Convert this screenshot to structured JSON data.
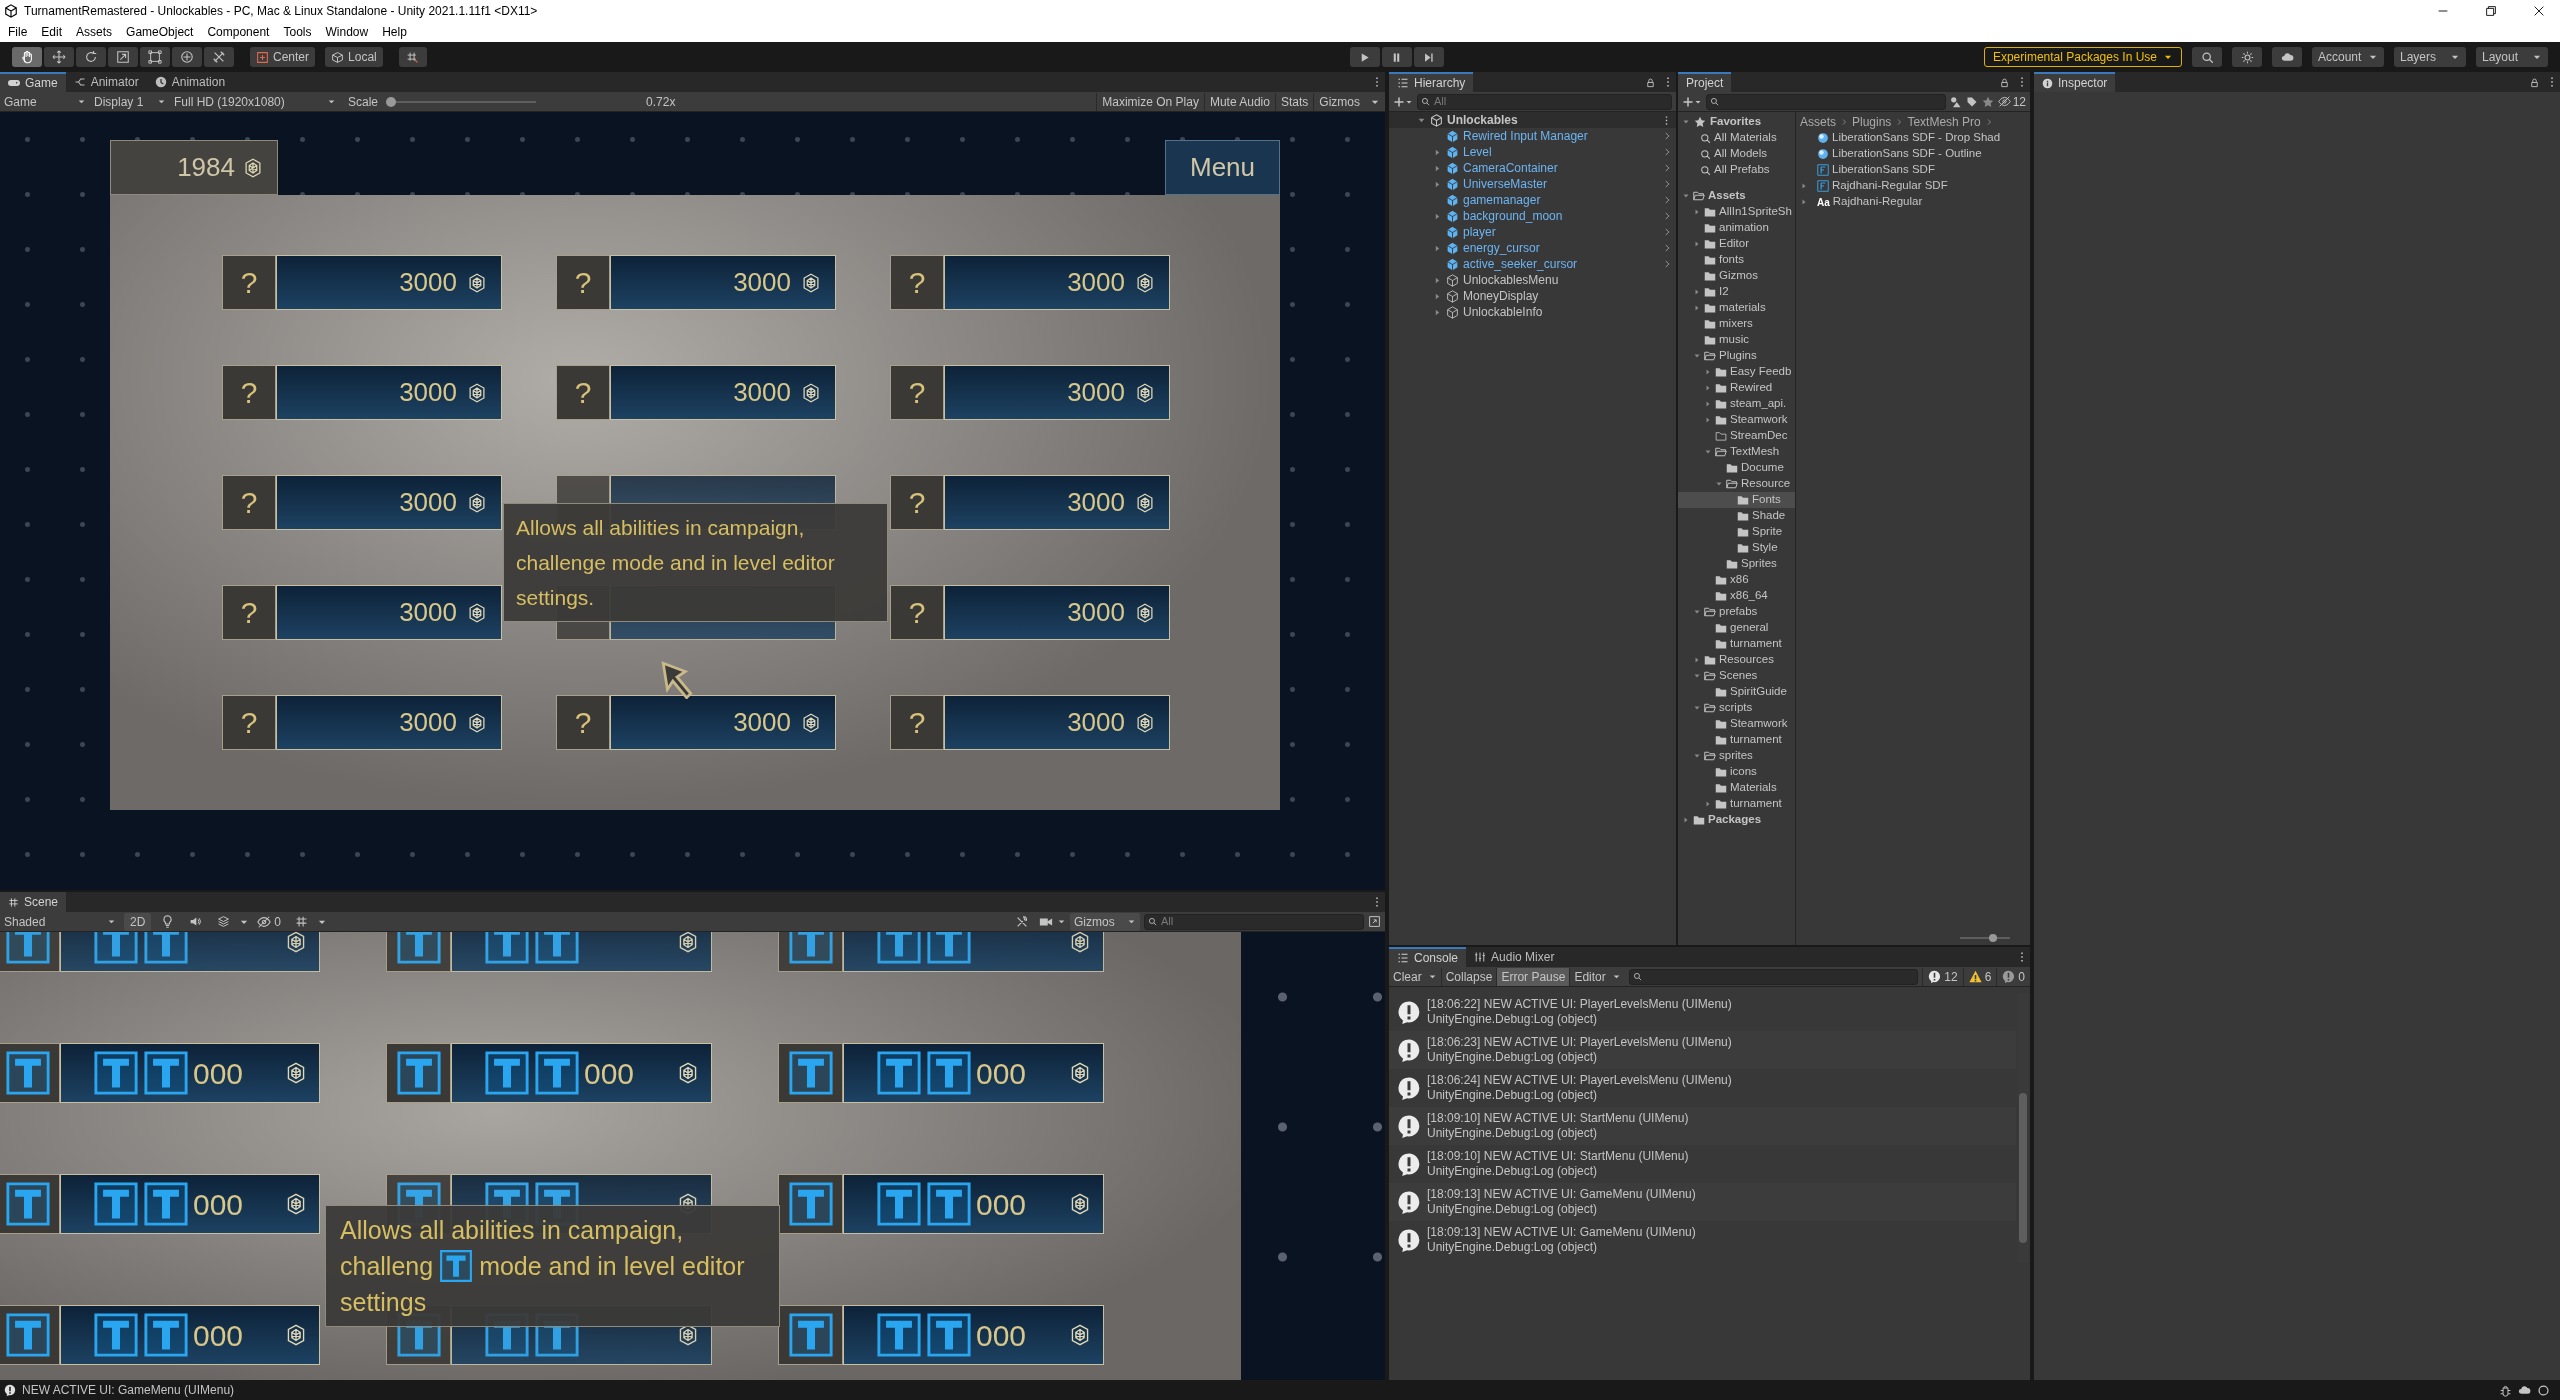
{
  "window": {
    "title": "TurnamentRemastered - Unlockables - PC, Mac & Linux Standalone - Unity 2021.1.11f1 <DX11>"
  },
  "menu_bar": [
    "File",
    "Edit",
    "Assets",
    "GameObject",
    "Component",
    "Tools",
    "Window",
    "Help"
  ],
  "toolbar": {
    "tools": [
      {
        "kind": "hand",
        "selected": true
      },
      {
        "kind": "move",
        "selected": false
      },
      {
        "kind": "rotate",
        "selected": false
      },
      {
        "kind": "scale",
        "selected": false
      },
      {
        "kind": "rect",
        "selected": false
      },
      {
        "kind": "transform",
        "selected": false
      },
      {
        "kind": "custom",
        "selected": false
      }
    ],
    "pivot": "Center",
    "space": "Local",
    "experimental": "Experimental Packages In Use",
    "account": "Account",
    "layers": "Layers",
    "layout": "Layout"
  },
  "game_panel": {
    "tabs": [
      {
        "label": "Game",
        "kind": "game",
        "selected": true
      },
      {
        "label": "Animator",
        "kind": "animator",
        "selected": false
      },
      {
        "label": "Animation",
        "kind": "animation",
        "selected": false
      }
    ],
    "view_mode": "Game",
    "display": "Display 1",
    "resolution": "Full HD (1920x1080)",
    "scale_label": "Scale",
    "scale": {
      "level": 0.0
    },
    "scale_reading": "0.72x",
    "options": [
      "Maximize On Play",
      "Mute Audio",
      "Stats",
      "Gizmos"
    ],
    "money": "1984",
    "menu_button": "Menu",
    "cards": [
      {
        "label": "?",
        "price": "3000"
      },
      {
        "label": "?",
        "price": "3000"
      },
      {
        "label": "?",
        "price": "3000"
      },
      {
        "label": "?",
        "price": "3000"
      },
      {
        "label": "?",
        "price": "3000"
      },
      {
        "label": "?",
        "price": "3000"
      },
      {
        "label": "?",
        "price": "3000"
      },
      {
        "covered": true
      },
      {
        "label": "?",
        "price": "3000"
      },
      {
        "label": "?",
        "price": "3000"
      },
      {
        "covered": true
      },
      {
        "label": "?",
        "price": "3000"
      },
      {
        "label": "?",
        "price": "3000"
      },
      {
        "label": "?",
        "price": "3000"
      },
      {
        "label": "?",
        "price": "3000"
      }
    ],
    "tooltip": [
      "Allows all abilities in campaign,",
      "challenge mode and in level editor",
      "settings."
    ]
  },
  "scene_panel": {
    "tab": "Scene",
    "shading": "Shaded",
    "mode_2d": "2D",
    "hidden_count": "0",
    "gizmos": "Gizmos",
    "search": {
      "placeholder": "All"
    },
    "cards": [
      {
        "covered": true
      },
      {
        "covered": true
      },
      {
        "covered": true
      },
      {
        "price": "000"
      },
      {
        "price": "000"
      },
      {
        "price": "000"
      },
      {
        "price": "000"
      },
      {
        "covered": true
      },
      {
        "price": "000"
      },
      {
        "price": "000"
      },
      {
        "covered": true
      },
      {
        "price": "000"
      }
    ],
    "tooltip": [
      [
        "Allows all abilities in campaign,"
      ],
      [
        "challeng",
        "mode and in level editor"
      ],
      [
        "settings"
      ]
    ]
  },
  "hierarchy": {
    "title": "Hierarchy",
    "search": {
      "placeholder": "All"
    },
    "scene": "Unlockables",
    "items": [
      {
        "label": "Rewired Input Manager",
        "kind": "prefab",
        "expandable": false
      },
      {
        "label": "Level",
        "kind": "prefab",
        "expandable": true
      },
      {
        "label": "CameraContainer",
        "kind": "prefab",
        "expandable": true
      },
      {
        "label": "UniverseMaster",
        "kind": "prefab",
        "expandable": true
      },
      {
        "label": "gamemanager",
        "kind": "prefab",
        "expandable": false
      },
      {
        "label": "background_moon",
        "kind": "prefab",
        "expandable": true
      },
      {
        "label": "player",
        "kind": "prefab",
        "expandable": false
      },
      {
        "label": "energy_cursor",
        "kind": "prefab",
        "expandable": true
      },
      {
        "label": "active_seeker_cursor",
        "kind": "prefab",
        "expandable": false
      },
      {
        "label": "UnlockablesMenu",
        "kind": "object",
        "expandable": true
      },
      {
        "label": "MoneyDisplay",
        "kind": "object",
        "expandable": true
      },
      {
        "label": "UnlockableInfo",
        "kind": "object",
        "expandable": true
      }
    ]
  },
  "project": {
    "title": "Project",
    "hidden_count": "12",
    "favorites_label": "Favorites",
    "favorites": [
      "All Materials",
      "All Models",
      "All Prefabs"
    ],
    "tree": [
      {
        "label": "Assets",
        "selected": false,
        "expanded": true,
        "children": [
          {
            "label": "AllIn1SpriteSh",
            "selected": false,
            "expanded": false
          },
          {
            "label": "animation",
            "selected": false
          },
          {
            "label": "Editor",
            "selected": false,
            "expanded": false
          },
          {
            "label": "fonts",
            "selected": false
          },
          {
            "label": "Gizmos",
            "selected": false
          },
          {
            "label": "I2",
            "selected": false,
            "expanded": false
          },
          {
            "label": "materials",
            "selected": false,
            "expanded": false
          },
          {
            "label": "mixers",
            "selected": false
          },
          {
            "label": "music",
            "selected": false
          },
          {
            "label": "Plugins",
            "selected": false,
            "expanded": true,
            "children": [
              {
                "label": "Easy Feedb",
                "kind": "folder",
                "selected": false,
                "expanded": false
              },
              {
                "label": "Rewired",
                "kind": "folder",
                "selected": false,
                "expanded": false
              },
              {
                "label": "steam_api.",
                "kind": "folder",
                "selected": false,
                "expanded": false
              },
              {
                "label": "Steamwork",
                "kind": "folder",
                "selected": false,
                "expanded": false
              },
              {
                "label": "StreamDec",
                "kind": "empty_folder",
                "selected": false
              },
              {
                "label": "TextMesh",
                "kind": "folder",
                "selected": false,
                "expanded": true,
                "children": [
                  {
                    "label": "Docume",
                    "selected": false
                  },
                  {
                    "label": "Resource",
                    "selected": false,
                    "expanded": true,
                    "children": [
                      {
                        "label": "Fonts",
                        "selected": true
                      },
                      {
                        "label": "Shade",
                        "selected": false
                      },
                      {
                        "label": "Sprite",
                        "selected": false
                      },
                      {
                        "label": "Style",
                        "selected": false
                      }
                    ]
                  },
                  {
                    "label": "Sprites",
                    "selected": false
                  }
                ]
              },
              {
                "label": "x86",
                "kind": "folder",
                "selected": false
              },
              {
                "label": "x86_64",
                "kind": "folder",
                "selected": false
              }
            ]
          },
          {
            "label": "prefabs",
            "selected": false,
            "expanded": true,
            "children": [
              {
                "label": "general",
                "selected": false
              },
              {
                "label": "turnament",
                "selected": false
              }
            ]
          },
          {
            "label": "Resources",
            "selected": false,
            "expanded": false
          },
          {
            "label": "Scenes",
            "selected": false,
            "expanded": true,
            "children": [
              {
                "label": "SpiritGuide",
                "selected": false
              }
            ]
          },
          {
            "label": "scripts",
            "selected": false,
            "expanded": true,
            "children": [
              {
                "label": "Steamwork",
                "selected": false
              },
              {
                "label": "turnament",
                "selected": false
              }
            ]
          },
          {
            "label": "sprites",
            "selected": false,
            "expanded": true,
            "children": [
              {
                "label": "icons",
                "selected": false
              },
              {
                "label": "Materials",
                "selected": false
              },
              {
                "label": "turnament",
                "selected": false,
                "expanded": false
              }
            ]
          }
        ]
      },
      {
        "label": "Packages",
        "selected": false,
        "expanded": false
      }
    ],
    "breadcrumb": [
      "Assets",
      "Plugins",
      "TextMesh Pro"
    ],
    "files": [
      {
        "label": "LiberationSans SDF - Drop Shad",
        "kind": "material",
        "expandable": false
      },
      {
        "label": "LiberationSans SDF - Outline",
        "kind": "material",
        "expandable": false
      },
      {
        "label": "LiberationSans SDF",
        "kind": "font_asset",
        "expandable": false
      },
      {
        "label": "Rajdhani-Regular SDF",
        "kind": "font_asset",
        "expandable": true
      },
      {
        "label": "Rajdhani-Regular",
        "kind": "font",
        "badge": "Aa",
        "expandable": true
      }
    ],
    "icon_size": {
      "level": 0.7
    }
  },
  "console": {
    "tabs": [
      {
        "label": "Console",
        "kind": "console",
        "selected": true
      },
      {
        "label": "Audio Mixer",
        "kind": "mixer",
        "selected": false
      }
    ],
    "buttons": [
      {
        "label": "Clear",
        "kind": "split"
      },
      {
        "label": "Collapse",
        "kind": "toggle",
        "on": false
      },
      {
        "label": "Error Pause",
        "kind": "toggle",
        "on": true
      },
      {
        "label": "Editor",
        "kind": "dropdown"
      }
    ],
    "counts": [
      {
        "kind": "info",
        "count": "12"
      },
      {
        "kind": "warning",
        "count": "6"
      },
      {
        "kind": "error",
        "count": "0"
      }
    ],
    "entries": [
      {
        "message": "[18:06:22] NEW ACTIVE UI: PlayerLevelsMenu (UIMenu)",
        "trace": "UnityEngine.Debug:Log (object)"
      },
      {
        "message": "[18:06:23] NEW ACTIVE UI: PlayerLevelsMenu (UIMenu)",
        "trace": "UnityEngine.Debug:Log (object)"
      },
      {
        "message": "[18:06:24] NEW ACTIVE UI: PlayerLevelsMenu (UIMenu)",
        "trace": "UnityEngine.Debug:Log (object)"
      },
      {
        "message": "[18:09:10] NEW ACTIVE UI: StartMenu (UIMenu)",
        "trace": "UnityEngine.Debug:Log (object)"
      },
      {
        "message": "[18:09:10] NEW ACTIVE UI: StartMenu (UIMenu)",
        "trace": "UnityEngine.Debug:Log (object)"
      },
      {
        "message": "[18:09:13] NEW ACTIVE UI: GameMenu (UIMenu)",
        "trace": "UnityEngine.Debug:Log (object)"
      },
      {
        "message": "[18:09:13] NEW ACTIVE UI: GameMenu (UIMenu)",
        "trace": "UnityEngine.Debug:Log (object)"
      }
    ]
  },
  "inspector": {
    "title": "Inspector"
  },
  "status_bar": {
    "message": "NEW ACTIVE UI: GameMenu (UIMenu)"
  }
}
